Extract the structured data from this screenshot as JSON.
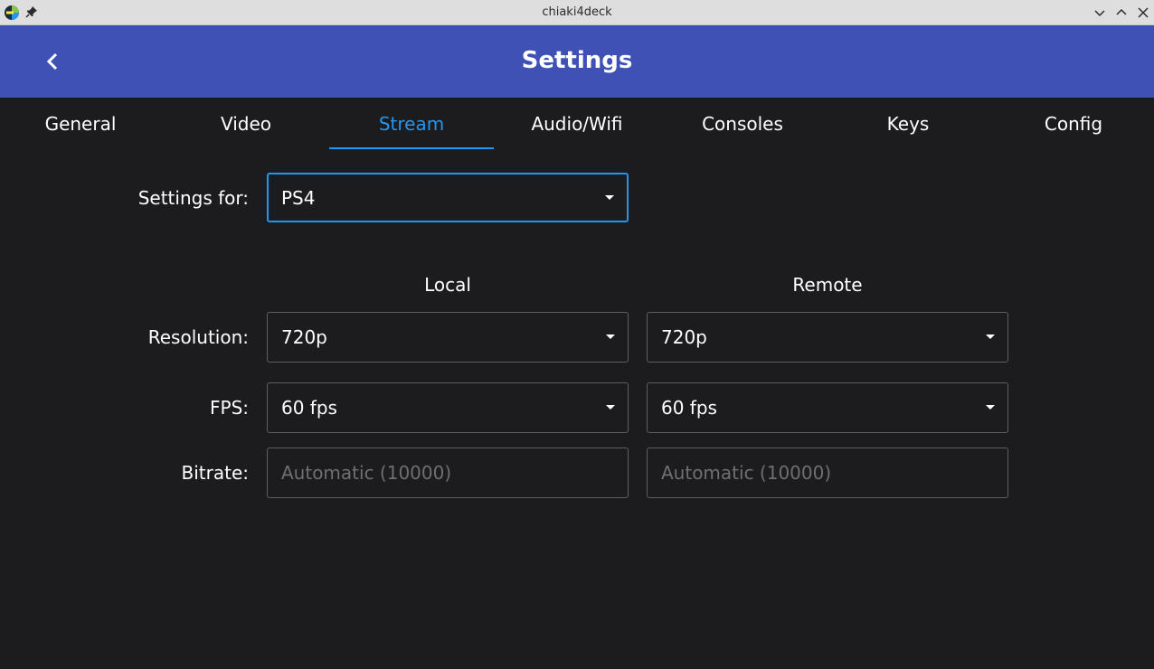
{
  "window": {
    "title": "chiaki4deck"
  },
  "header": {
    "title": "Settings",
    "back_icon": "chevron-left-icon"
  },
  "tabs": [
    {
      "label": "General",
      "active": false
    },
    {
      "label": "Video",
      "active": false
    },
    {
      "label": "Stream",
      "active": true
    },
    {
      "label": "Audio/Wifi",
      "active": false
    },
    {
      "label": "Consoles",
      "active": false
    },
    {
      "label": "Keys",
      "active": false
    },
    {
      "label": "Config",
      "active": false
    }
  ],
  "form": {
    "settings_for": {
      "label": "Settings for:",
      "value": "PS4"
    },
    "columns": {
      "local": "Local",
      "remote": "Remote"
    },
    "resolution": {
      "label": "Resolution:",
      "local": "720p",
      "remote": "720p"
    },
    "fps": {
      "label": "FPS:",
      "local": "60 fps",
      "remote": "60 fps"
    },
    "bitrate": {
      "label": "Bitrate:",
      "local_placeholder": "Automatic (10000)",
      "remote_placeholder": "Automatic (10000)"
    }
  },
  "colors": {
    "header_bg": "#3f51b5",
    "accent": "#2196f3",
    "background": "#1c1c1e"
  }
}
